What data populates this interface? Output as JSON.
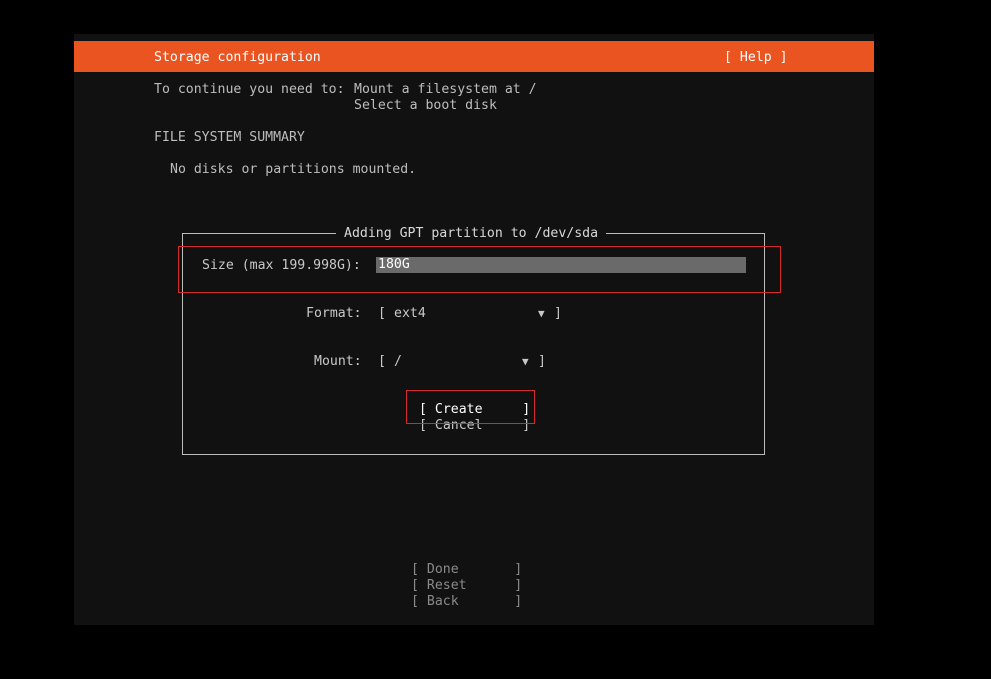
{
  "header": {
    "title": "Storage configuration",
    "help": "[ Help ]"
  },
  "notice": {
    "prefix": "To continue you need to:",
    "line1": "Mount a filesystem at /",
    "line2": "Select a boot disk"
  },
  "summary": {
    "heading": "FILE SYSTEM SUMMARY",
    "empty_text": "No disks or partitions mounted."
  },
  "dialog": {
    "title": "Adding GPT partition to /dev/sda",
    "size_label": "Size (max 199.998G):",
    "size_value": "180G",
    "format_label": "Format:",
    "format_value": "ext4",
    "mount_label": "Mount:",
    "mount_value": "/",
    "bracket_open": "[",
    "bracket_close": "]",
    "arrow": "▼",
    "create_label": "[ Create     ]",
    "cancel_label": "[ Cancel     ]"
  },
  "footer": {
    "done_label": "[ Done       ]",
    "reset_label": "[ Reset      ]",
    "back_label": "[ Back       ]"
  },
  "colors": {
    "accent": "#e95420",
    "highlight": "#d42a2a",
    "background": "#111111"
  }
}
